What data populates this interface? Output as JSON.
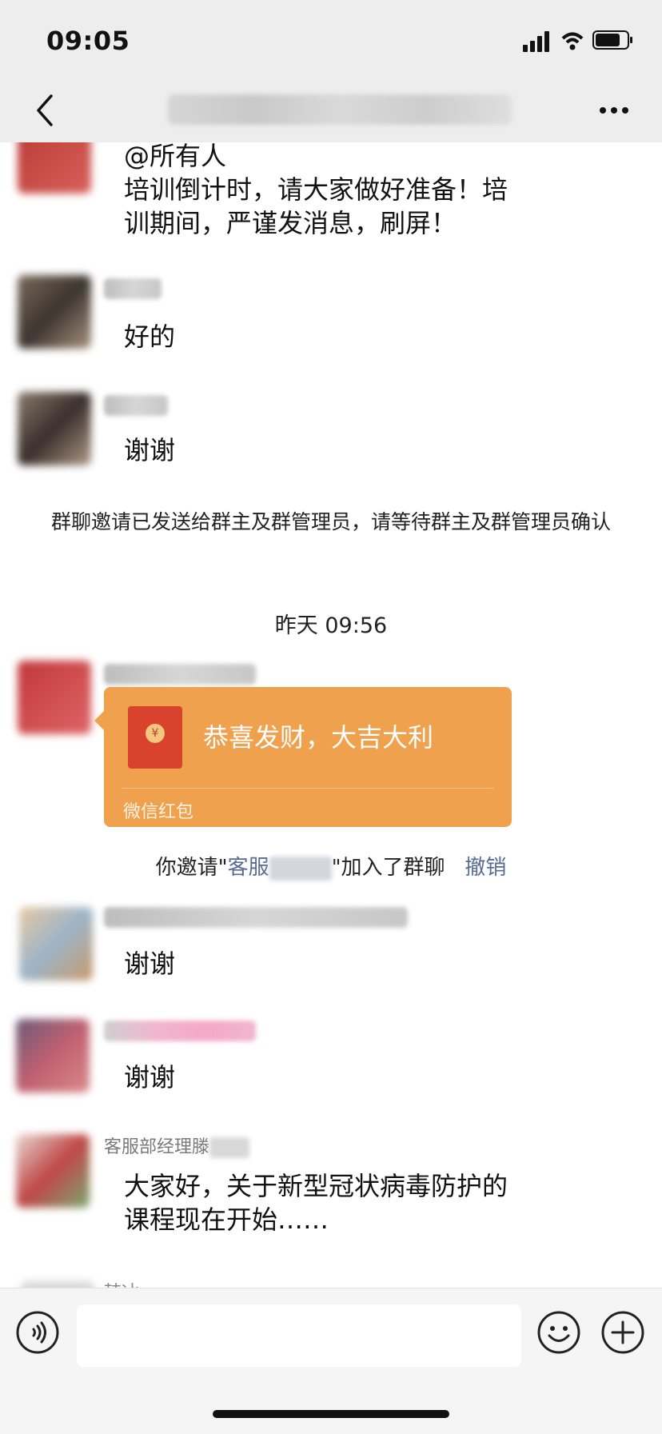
{
  "status_bar": {
    "time": "09:05"
  },
  "header": {
    "title": "",
    "back_icon": "chevron-left-icon",
    "more_icon": "ellipsis-icon"
  },
  "messages": [
    {
      "lines": [
        "@所有人",
        "培训倒计时，请大家做好准备！培",
        "训期间，严谨发消息，刷屏！"
      ]
    },
    {
      "text": "好的"
    },
    {
      "text": "谢谢"
    },
    {
      "system": "群聊邀请已发送给群主及群管理员，请等待群主及群管理员确认"
    },
    {
      "timestamp": "昨天 09:56"
    },
    {
      "red_packet": {
        "text": "恭喜发财，大吉大利",
        "label": "微信红包",
        "color": "#f0a14e"
      }
    },
    {
      "invite": {
        "prefix": "你邀请\"",
        "name": "客服",
        "suffix": "\"加入了群聊",
        "action": "撤销"
      }
    },
    {
      "text": "谢谢"
    },
    {
      "text": "谢谢"
    },
    {
      "sender": "客服部经理滕",
      "lines": [
        "大家好，关于新型冠状病毒防护的",
        "课程现在开始……"
      ]
    },
    {
      "sender_partial": "韩冰"
    }
  ],
  "input_bar": {
    "placeholder": "",
    "voice_icon": "voice-icon",
    "emoji_icon": "emoji-icon",
    "plus_icon": "plus-icon"
  },
  "colors": {
    "bg": "#ffffff",
    "bar": "#ededed",
    "red_packet": "#f0a14e",
    "link": "#576b95"
  }
}
